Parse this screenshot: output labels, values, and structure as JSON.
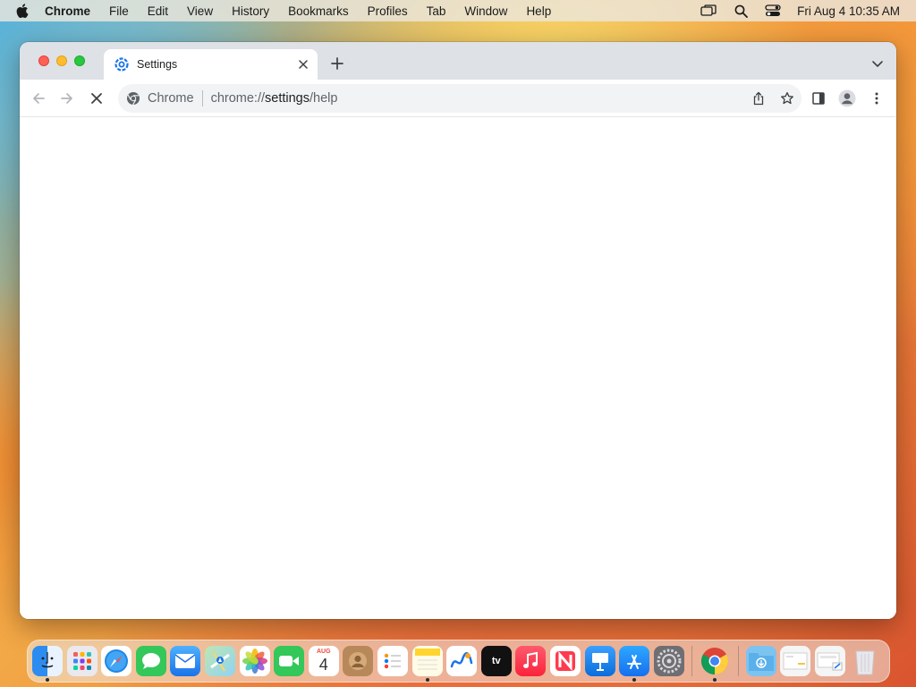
{
  "menubar": {
    "app_name": "Chrome",
    "items": [
      "File",
      "Edit",
      "View",
      "History",
      "Bookmarks",
      "Profiles",
      "Tab",
      "Window",
      "Help"
    ],
    "clock": "Fri Aug 4  10:35 AM"
  },
  "window": {
    "tab": {
      "title": "Settings",
      "favicon": "chrome-settings-icon"
    },
    "omnibox": {
      "site_label": "Chrome",
      "url_scheme": "chrome://",
      "url_host": "settings",
      "url_path": "/help"
    }
  },
  "dock": {
    "apps": [
      {
        "name": "Finder",
        "icon": "finder-icon",
        "running": true
      },
      {
        "name": "Launchpad",
        "icon": "launchpad-icon",
        "running": false
      },
      {
        "name": "Safari",
        "icon": "safari-icon",
        "running": false
      },
      {
        "name": "Messages",
        "icon": "messages-icon",
        "running": false
      },
      {
        "name": "Mail",
        "icon": "mail-icon",
        "running": false
      },
      {
        "name": "Maps",
        "icon": "maps-icon",
        "running": false
      },
      {
        "name": "Photos",
        "icon": "photos-icon",
        "running": false
      },
      {
        "name": "FaceTime",
        "icon": "facetime-icon",
        "running": false
      },
      {
        "name": "Calendar",
        "icon": "calendar-icon",
        "running": false,
        "month": "AUG",
        "day": "4"
      },
      {
        "name": "Contacts",
        "icon": "contacts-icon",
        "running": false
      },
      {
        "name": "Reminders",
        "icon": "reminders-icon",
        "running": false
      },
      {
        "name": "Notes",
        "icon": "notes-icon",
        "running": true
      },
      {
        "name": "Freeform",
        "icon": "freeform-icon",
        "running": false
      },
      {
        "name": "TV",
        "icon": "tv-icon",
        "running": false,
        "label": "tv"
      },
      {
        "name": "Music",
        "icon": "music-icon",
        "running": false
      },
      {
        "name": "News",
        "icon": "news-icon",
        "running": false
      },
      {
        "name": "Keynote",
        "icon": "keynote-icon",
        "running": false
      },
      {
        "name": "App Store",
        "icon": "app-store-icon",
        "running": true
      },
      {
        "name": "System Settings",
        "icon": "system-settings-icon",
        "running": false
      },
      {
        "name": "Google Chrome",
        "icon": "chrome-icon",
        "running": true
      }
    ],
    "stacks": [
      {
        "name": "Downloads",
        "icon": "downloads-folder-icon"
      },
      {
        "name": "Document stack",
        "icon": "document-stack-icon"
      },
      {
        "name": "Screenshot stack",
        "icon": "screenshot-stack-icon"
      },
      {
        "name": "Trash",
        "icon": "trash-icon"
      }
    ]
  },
  "colors": {
    "tabstrip": "#dee1e6",
    "close": "#fe5f57",
    "minimize": "#febc2e",
    "maximize": "#28c840"
  }
}
